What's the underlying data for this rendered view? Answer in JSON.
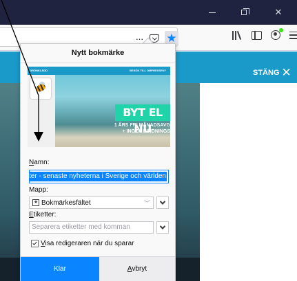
{
  "window": {
    "minimize_glyph": "minimize-icon",
    "maximize_glyph": "restore-icon",
    "close_glyph": "✕"
  },
  "toolbar": {
    "more_actions": "···",
    "star_glyph": "★"
  },
  "page": {
    "close_label": "STÄNG",
    "close_glyph": "✕",
    "preview_brand": "GRÖNKLÄDD",
    "preview_link": "BESÖK TILL OMPRESSEN?",
    "preview_headline": "BYT EL NU",
    "preview_offer_1": "1 ÅRS FRI MÅNADSAVG",
    "preview_offer_2": "+ INGEN BINDNINGS"
  },
  "panel": {
    "title": "Nytt bokmärke",
    "name_label": "Namn:",
    "name_value": "eter - senaste nyheterna i Sverige och världen",
    "folder_label": "Mapp:",
    "folder_value": "Bokmärkesfältet",
    "tags_label": "Etiketter:",
    "tags_placeholder": "Separera etiketter med komman",
    "show_editor_label": "Visa redigeraren när du sparar",
    "show_editor_checked": true,
    "done_label": "Klar",
    "cancel_label": "Avbryt"
  },
  "colors": {
    "titlebar": "#202340",
    "accent": "#0a84ff",
    "page_band": "#1a9ac9"
  }
}
